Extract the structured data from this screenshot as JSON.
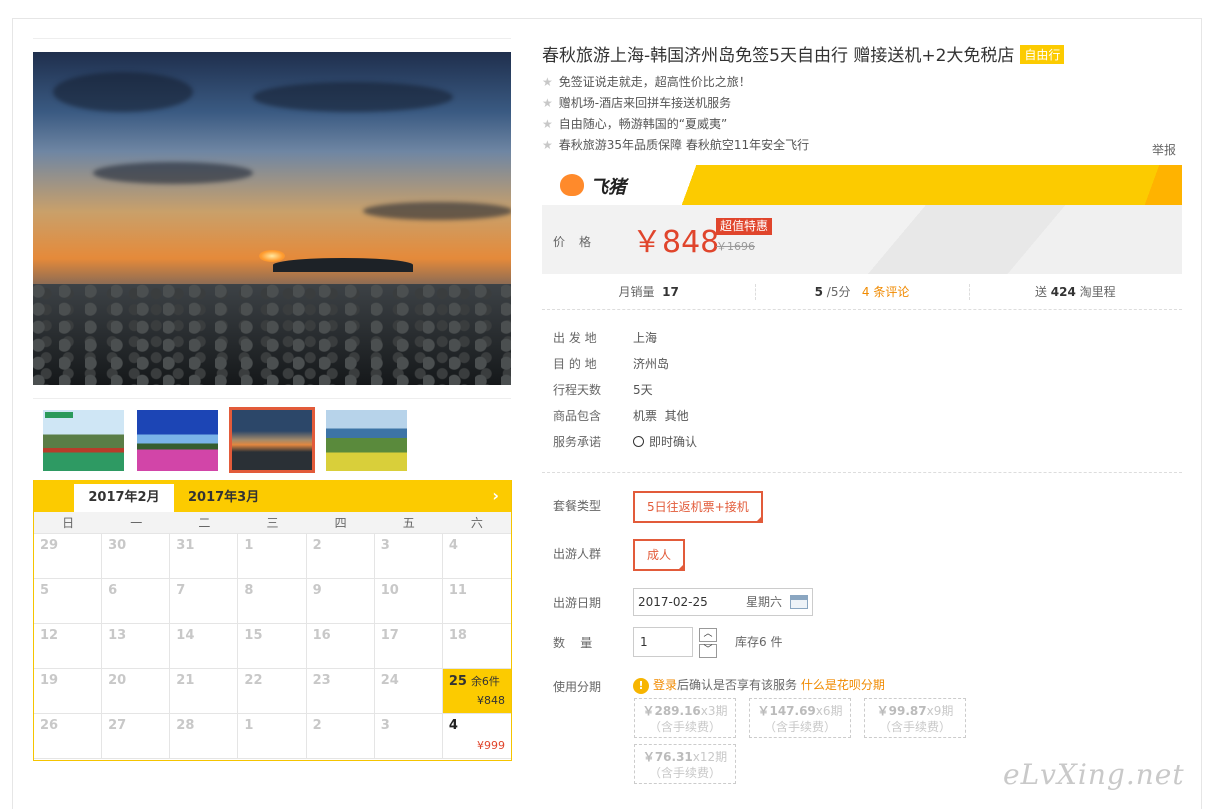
{
  "title": "春秋旅游上海-韩国济州岛免签5天自由行 赠接送机+2大免税店",
  "title_badge": "自由行",
  "features": [
    "免签证说走就走，超高性价比之旅！",
    "赠机场-酒店来回拼车接送机服务",
    "自由随心，畅游韩国的“夏威夷”",
    "春秋旅游35年品质保障 春秋航空11年安全飞行"
  ],
  "report_link": "举报",
  "brand": "飞猪",
  "price": {
    "label": "价格",
    "current": "￥848",
    "deal_badge": "超值特惠",
    "original": "￥1696"
  },
  "stats": {
    "monthly_sales_label": "月销量",
    "monthly_sales": "17",
    "rating": "5",
    "rating_suffix": "/5分",
    "reviews": "4 条评论",
    "points_prefix": "送",
    "points": "424",
    "points_suffix": "淘里程"
  },
  "info": [
    {
      "key": "出 发 地",
      "value": "上海"
    },
    {
      "key": "目 的 地",
      "value": "济州岛"
    },
    {
      "key": "行程天数",
      "value": "5天"
    },
    {
      "key": "商品包含",
      "value": "机票  其他"
    },
    {
      "key": "服务承诺",
      "value": "即时确认"
    }
  ],
  "options": {
    "package_label": "套餐类型",
    "package_value": "5日往返机票+接机",
    "group_label": "出游人群",
    "group_value": "成人",
    "date_label": "出游日期",
    "date_value": "2017-02-25",
    "date_weekday": "星期六",
    "qty_label": "数    量",
    "qty_value": "1",
    "stock": "库存6 件",
    "installment_label": "使用分期",
    "installment_login": "登录",
    "installment_text": "后确认是否享有该服务",
    "installment_link": "什么是花呗分期",
    "installments": [
      {
        "amount": "￥289.16",
        "periods": "x3期",
        "note": "（含手续费）"
      },
      {
        "amount": "￥147.69",
        "periods": "x6期",
        "note": "（含手续费）"
      },
      {
        "amount": "￥99.87",
        "periods": "x9期",
        "note": "（含手续费）"
      },
      {
        "amount": "￥76.31",
        "periods": "x12期",
        "note": "（含手续费）"
      }
    ]
  },
  "calendar": {
    "tab_active": "2017年2月",
    "tab_other": "2017年3月",
    "next_icon": "chevron-right-icon",
    "weekdays": [
      "日",
      "一",
      "二",
      "三",
      "四",
      "五",
      "六"
    ],
    "days": [
      "29",
      "30",
      "31",
      "1",
      "2",
      "3",
      "4",
      "5",
      "6",
      "7",
      "8",
      "9",
      "10",
      "11",
      "12",
      "13",
      "14",
      "15",
      "16",
      "17",
      "18",
      "19",
      "20",
      "21",
      "22",
      "23",
      "24",
      "25",
      "26",
      "27",
      "28",
      "1",
      "2",
      "3",
      "4"
    ],
    "available": [
      {
        "index": 27,
        "stock": "余6件",
        "price": "¥848"
      },
      {
        "index": 34,
        "stock": "",
        "price": "¥999"
      }
    ]
  },
  "watermark": "eLvXing.net",
  "colors": {
    "accent": "#fccb00",
    "price": "#e0452c",
    "link": "#f08a00"
  }
}
